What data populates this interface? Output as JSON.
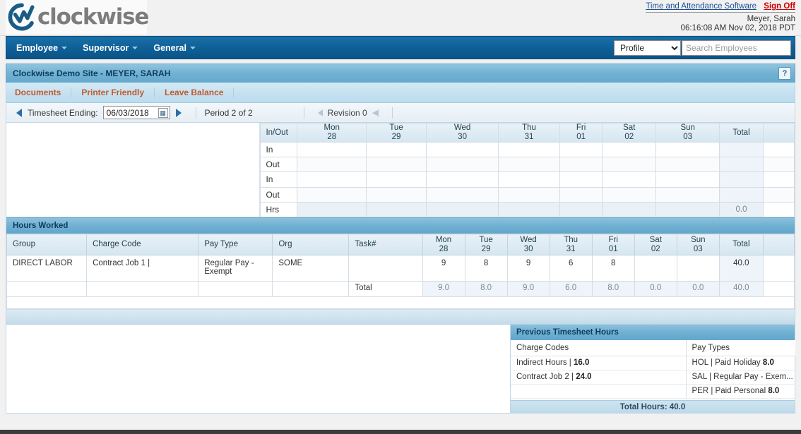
{
  "brand": {
    "name": "clockwise",
    "logo_icon": "clockwise-logo-icon",
    "accent_blue": "#0b5488",
    "accent_orange": "#c05a2e"
  },
  "header": {
    "app_link": "Time and Attendance Software",
    "sign_off": "Sign Off",
    "user": "Meyer, Sarah",
    "timestamp": "06:16:08 AM Nov 02, 2018 PDT"
  },
  "nav": {
    "items": [
      {
        "label": "Employee",
        "icon": "chevron-down-icon"
      },
      {
        "label": "Supervisor",
        "icon": "chevron-down-icon"
      },
      {
        "label": "General",
        "icon": "chevron-down-icon"
      }
    ],
    "profile_select": "Profile",
    "search_placeholder": "Search Employees",
    "search_value": ""
  },
  "site": {
    "title": "Clockwise Demo Site - MEYER, SARAH",
    "help_label": "?",
    "links": [
      "Documents",
      "Printer Friendly",
      "Leave Balance"
    ]
  },
  "timesheet_nav": {
    "label": "Timesheet Ending:",
    "date": "06/03/2018",
    "calendar_icon": "calendar-icon",
    "period": "Period 2 of 2",
    "revision": "Revision 0"
  },
  "inout": {
    "label_header": "In/Out",
    "days": [
      {
        "dow": "Mon",
        "dom": "28"
      },
      {
        "dow": "Tue",
        "dom": "29"
      },
      {
        "dow": "Wed",
        "dom": "30"
      },
      {
        "dow": "Thu",
        "dom": "31"
      },
      {
        "dow": "Fri",
        "dom": "01"
      },
      {
        "dow": "Sat",
        "dom": "02"
      },
      {
        "dow": "Sun",
        "dom": "03"
      }
    ],
    "total_header": "Total",
    "rows": [
      {
        "label": "In",
        "values": [
          "",
          "",
          "",
          "",
          "",
          "",
          ""
        ],
        "total": ""
      },
      {
        "label": "Out",
        "values": [
          "",
          "",
          "",
          "",
          "",
          "",
          ""
        ],
        "total": ""
      },
      {
        "label": "In",
        "values": [
          "",
          "",
          "",
          "",
          "",
          "",
          ""
        ],
        "total": ""
      },
      {
        "label": "Out",
        "values": [
          "",
          "",
          "",
          "",
          "",
          "",
          ""
        ],
        "total": ""
      },
      {
        "label": "Hrs",
        "values": [
          "",
          "",
          "",
          "",
          "",
          "",
          ""
        ],
        "total": "0.0"
      }
    ]
  },
  "hours_worked": {
    "section_title": "Hours Worked",
    "columns": [
      "Group",
      "Charge Code",
      "Pay Type",
      "Org",
      "Task#"
    ],
    "days": [
      {
        "dow": "Mon",
        "dom": "28"
      },
      {
        "dow": "Tue",
        "dom": "29"
      },
      {
        "dow": "Wed",
        "dom": "30"
      },
      {
        "dow": "Thu",
        "dom": "31"
      },
      {
        "dow": "Fri",
        "dom": "01"
      },
      {
        "dow": "Sat",
        "dom": "02"
      },
      {
        "dow": "Sun",
        "dom": "03"
      }
    ],
    "total_header": "Total",
    "rows": [
      {
        "group": "DIRECT LABOR",
        "charge_code": "Contract Job 1 |",
        "pay_type": "Regular Pay - Exempt",
        "org": "SOME",
        "task": "",
        "values": [
          "9",
          "8",
          "9",
          "6",
          "8",
          "",
          ""
        ],
        "total": "40.0"
      }
    ],
    "total_row": {
      "label": "Total",
      "values": [
        "9.0",
        "8.0",
        "9.0",
        "6.0",
        "8.0",
        "0.0",
        "0.0"
      ],
      "total": "40.0"
    }
  },
  "previous_timesheet": {
    "title": "Previous Timesheet Hours",
    "col_charge_codes": "Charge Codes",
    "col_pay_types": "Pay Types",
    "charge_codes": [
      {
        "name": "Indirect Hours |",
        "hours": "16.0"
      },
      {
        "name": "Contract Job 2 |",
        "hours": "24.0"
      }
    ],
    "pay_types": [
      {
        "name": "HOL | Paid Holiday",
        "hours": "8.0"
      },
      {
        "name": "SAL | Regular Pay - Exem...",
        "hours": ""
      },
      {
        "name": "PER | Paid Personal",
        "hours": "8.0"
      }
    ],
    "footer": "Total Hours: 40.0"
  }
}
